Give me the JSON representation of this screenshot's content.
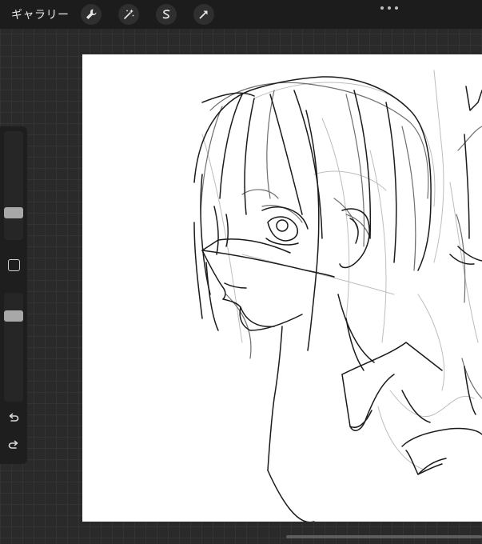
{
  "topbar": {
    "gallery_label": "ギャラリー",
    "tools": [
      {
        "icon": "wrench-icon"
      },
      {
        "icon": "magic-wand-icon"
      },
      {
        "icon": "selection-icon"
      },
      {
        "icon": "transform-arrow-icon"
      }
    ],
    "more_icon": "more-dots-icon"
  },
  "sidebar": {
    "brush_size_level": 0.78,
    "opacity_level": 0.18,
    "modify_icon": "square-icon",
    "undo_icon": "undo-icon",
    "redo_icon": "redo-icon"
  },
  "canvas": {
    "background": "#ffffff",
    "content": "sketch-drawing"
  },
  "colors": {
    "topbar": "#1c1c1c",
    "workspace": "#2a2a2a",
    "sidebar": "#1e1e1e",
    "slider_thumb": "#a8a8a8"
  }
}
